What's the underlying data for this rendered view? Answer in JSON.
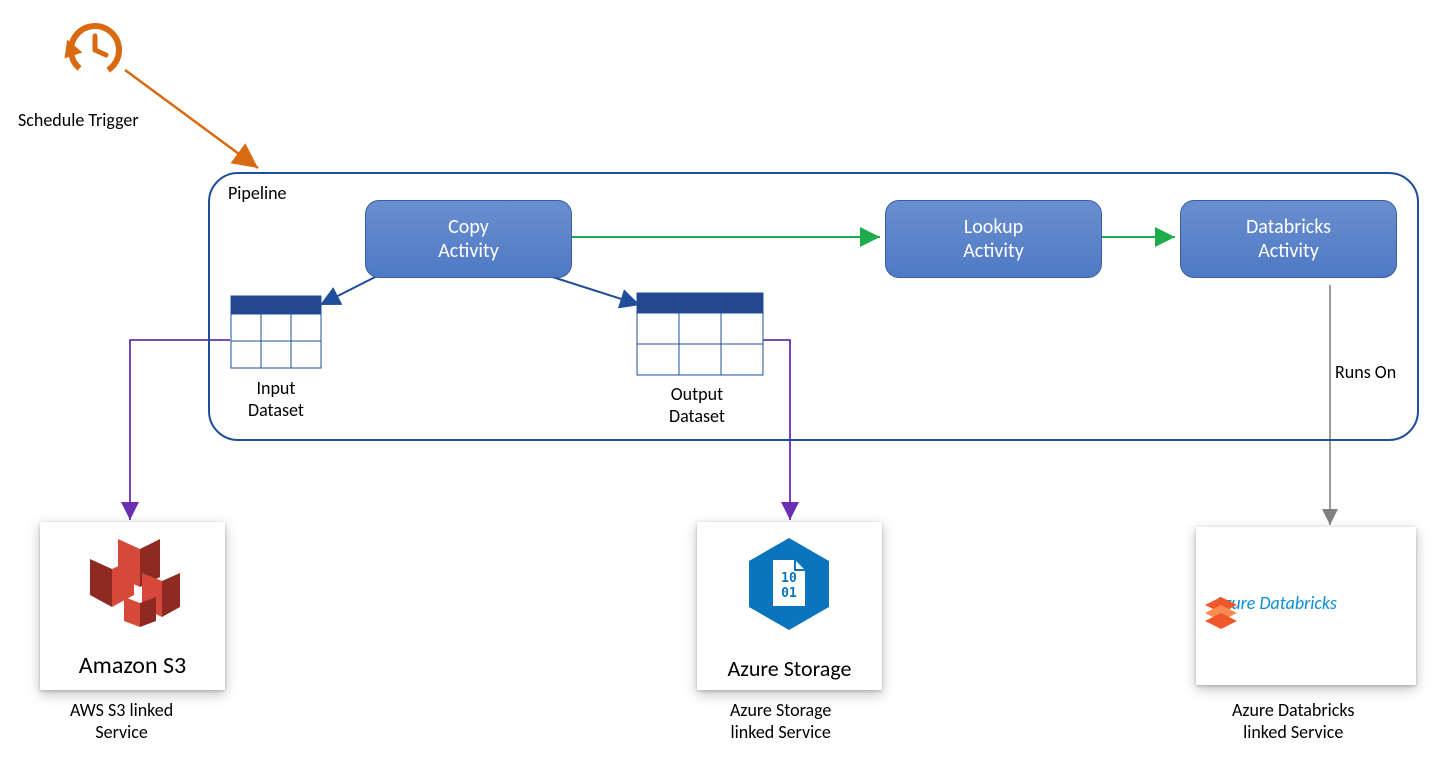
{
  "trigger": {
    "label": "Schedule Trigger"
  },
  "pipeline": {
    "label": "Pipeline"
  },
  "activities": {
    "copy": {
      "label": "Copy\nActivity"
    },
    "lookup": {
      "label": "Lookup\nActivity"
    },
    "databricks": {
      "label": "Databricks\nActivity"
    }
  },
  "datasets": {
    "input": {
      "label": "Input\nDataset"
    },
    "output": {
      "label": "Output\nDataset"
    }
  },
  "runs_on": "Runs On",
  "services": {
    "s3": {
      "title": "Amazon S3",
      "label": "AWS S3 linked\nService"
    },
    "azure_store": {
      "title": "Azure Storage",
      "label": "Azure Storage\nlinked Service"
    },
    "databricks": {
      "title": "Azure Databricks",
      "label": "Azure Databricks\nlinked Service"
    }
  },
  "colors": {
    "orange": "#d96a12",
    "blue": "#1f4e9c",
    "green": "#1eab4b",
    "purple": "#6b2fb3",
    "gray": "#808080",
    "activity": "#5a82c8",
    "azure": "#0a74bd",
    "s3red": "#c8372b",
    "dbOrange": "#f0572b"
  }
}
